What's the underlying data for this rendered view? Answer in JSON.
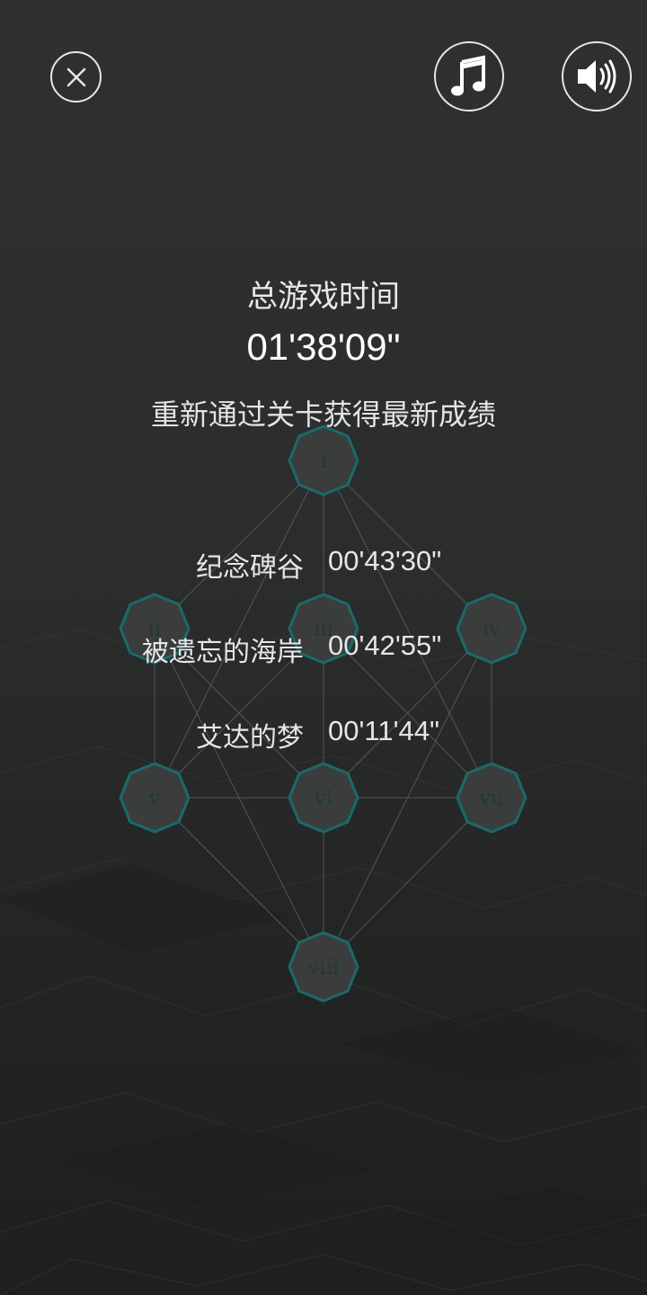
{
  "header": {
    "close_icon": "close-circle-icon",
    "music_icon": "music-note-icon",
    "sound_icon": "speaker-volume-icon"
  },
  "summary": {
    "title": "总游戏时间",
    "total_time": "01'38'09\"",
    "hint": "重新通过关卡获得最新成绩"
  },
  "records": [
    {
      "name": "纪念碑谷",
      "time": "00'43'30\""
    },
    {
      "name": "被遗忘的海岸",
      "time": "00'42'55\""
    },
    {
      "name": "艾达的梦",
      "time": "00'11'44\""
    }
  ],
  "level_map": {
    "nodes": [
      "i",
      "ii",
      "iii",
      "iv",
      "v",
      "vi",
      "vii",
      "viii"
    ]
  },
  "colors": {
    "accent": "#1a6a6a",
    "node_fill": "#3b3d3d",
    "text": "#e9e9e9"
  }
}
